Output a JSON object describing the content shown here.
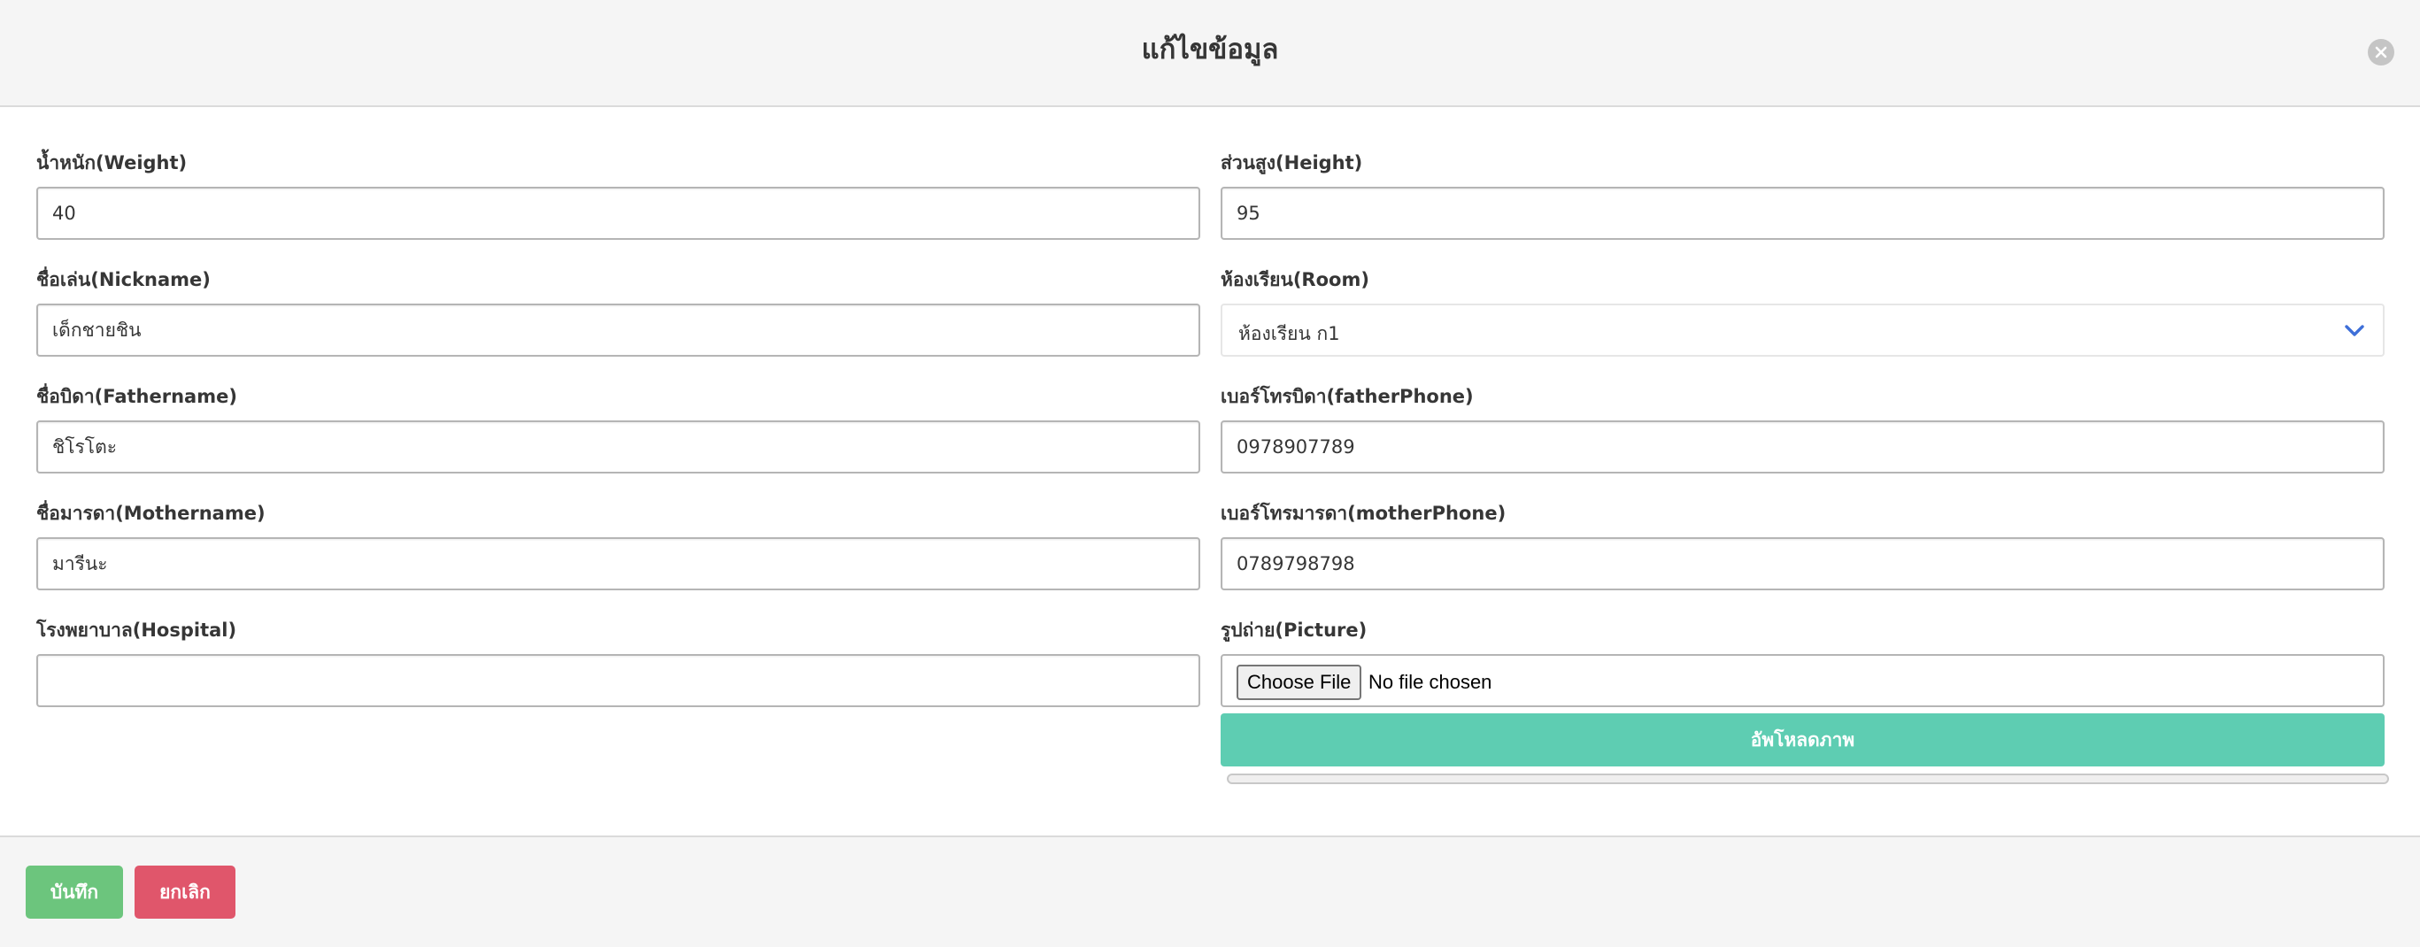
{
  "dialog": {
    "title": "แก้ไขข้อมูล"
  },
  "fields": {
    "weight": {
      "label": "น้ำหนัก(Weight)",
      "value": "40"
    },
    "height": {
      "label": "ส่วนสูง(Height)",
      "value": "95"
    },
    "nickname": {
      "label": "ชื่อเล่น(Nickname)",
      "value": "เด็กชายชิน"
    },
    "room": {
      "label": "ห้องเรียน(Room)",
      "selected": "ห้องเรียน ก1"
    },
    "fathername": {
      "label": "ชื่อบิดา(Fathername)",
      "value": "ชิโรโตะ"
    },
    "father_phone": {
      "label": "เบอร์โทรบิดา(fatherPhone)",
      "value": "0978907789"
    },
    "mothername": {
      "label": "ชื่อมารดา(Mothername)",
      "value": "มารีนะ"
    },
    "mother_phone": {
      "label": "เบอร์โทรมารดา(motherPhone)",
      "value": "0789798798"
    },
    "hospital": {
      "label": "โรงพยาบาล(Hospital)",
      "value": ""
    },
    "picture": {
      "label": "รูปถ่าย(Picture)",
      "button_label": "Choose File",
      "status": "No file chosen"
    }
  },
  "upload": {
    "label": "อัพโหลดภาพ",
    "progress": 0
  },
  "footer": {
    "save_label": "บันทึก",
    "cancel_label": "ยกเลิก"
  },
  "colors": {
    "upload": "#5ecdb2",
    "save": "#6cc57d",
    "cancel": "#e0566b",
    "select_arrow": "#3e6fd8"
  }
}
